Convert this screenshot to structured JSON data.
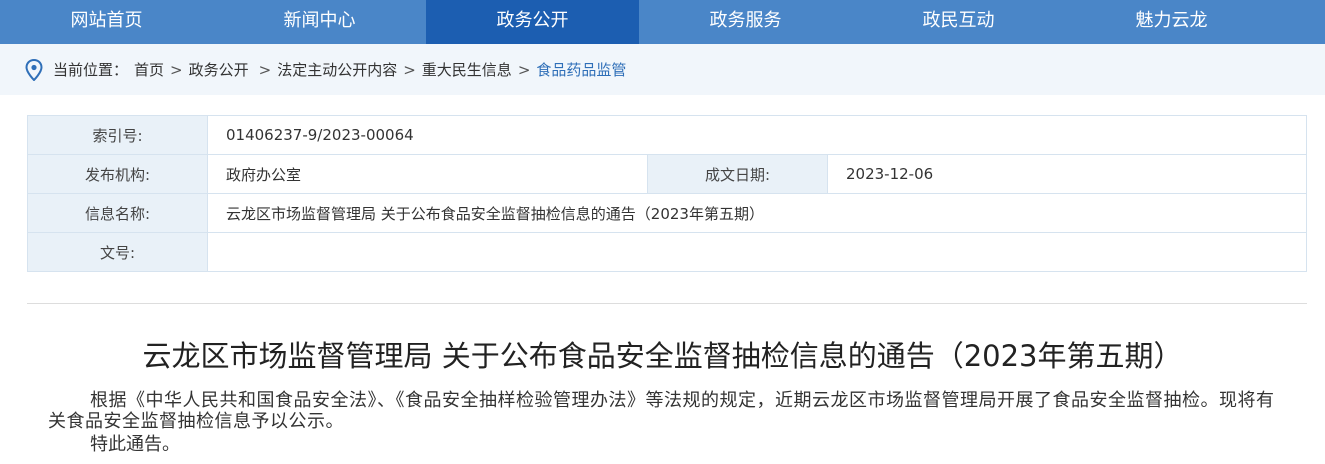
{
  "nav": {
    "items": [
      {
        "label": "网站首页"
      },
      {
        "label": "新闻中心"
      },
      {
        "label": "政务公开"
      },
      {
        "label": "政务服务"
      },
      {
        "label": "政民互动"
      },
      {
        "label": "魅力云龙"
      }
    ],
    "active_index": 2
  },
  "breadcrumb": {
    "prefix": "当前位置：",
    "items": [
      "首页",
      "政务公开",
      "法定主动公开内容",
      "重大民生信息"
    ],
    "current": "食品药品监管",
    "separator": ">"
  },
  "meta": {
    "index_label": "索引号:",
    "index_value": "01406237-9/2023-00064",
    "publisher_label": "发布机构:",
    "publisher_value": "政府办公室",
    "date_label": "成文日期:",
    "date_value": "2023-12-06",
    "name_label": "信息名称:",
    "name_value": "云龙区市场监督管理局 关于公布食品安全监督抽检信息的通告（2023年第五期）",
    "docno_label": "文号:",
    "docno_value": ""
  },
  "article": {
    "title": "云龙区市场监督管理局 关于公布食品安全监督抽检信息的通告（2023年第五期）",
    "paragraph1": "根据《中华人民共和国食品安全法》、《食品安全抽样检验管理办法》等法规的规定，近期云龙区市场监督管理局开展了食品安全监督抽检。现将有关食品安全监督抽检信息予以公示。",
    "paragraph2": "特此通告。"
  },
  "colors": {
    "nav_bg": "#4a86c8",
    "nav_active": "#1c5eb1",
    "breadcrumb_bg": "#f1f6fb",
    "label_bg": "#e9f1f8",
    "current_crumb": "#2f6fb8"
  },
  "icons": {
    "location": "location-pin-icon"
  }
}
